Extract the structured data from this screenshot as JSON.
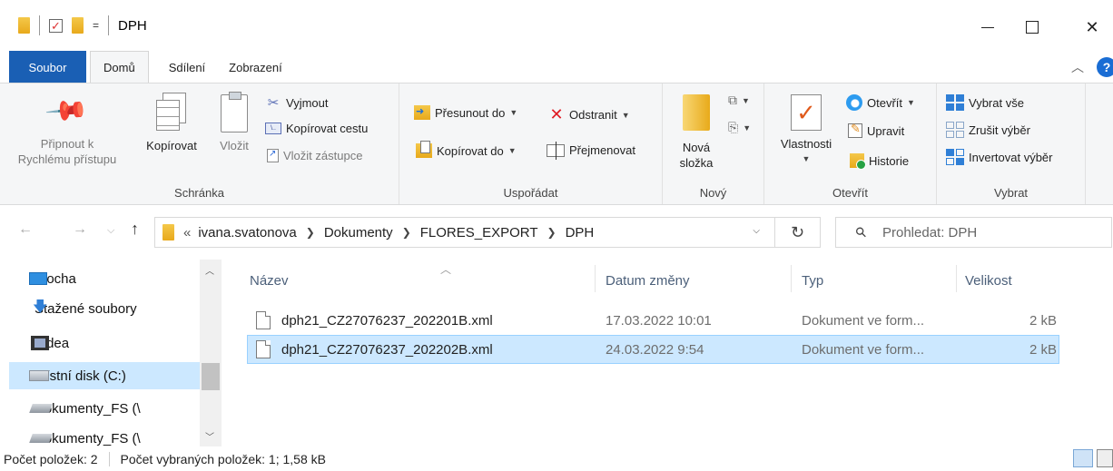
{
  "window": {
    "title": "DPH",
    "qat_dropdown": "=",
    "controls": {
      "minimize": "—",
      "maximize": "☐",
      "close": "✕"
    }
  },
  "tabs": [
    "Soubor",
    "Domů",
    "Sdílení",
    "Zobrazení"
  ],
  "ribbon": {
    "clipboard": {
      "pin_line1": "Připnout k",
      "pin_line2": "Rychlému přístupu",
      "copy": "Kopírovat",
      "paste": "Vložit",
      "cut": "Vyjmout",
      "copy_path": "Kopírovat cestu",
      "paste_shortcut": "Vložit zástupce",
      "group": "Schránka"
    },
    "organize": {
      "move_to": "Přesunout do",
      "delete": "Odstranit",
      "copy_to": "Kopírovat do",
      "rename": "Přejmenovat",
      "group": "Uspořádat"
    },
    "new": {
      "new_folder_line1": "Nová",
      "new_folder_line2": "složka",
      "group": "Nový"
    },
    "open": {
      "properties": "Vlastnosti",
      "open": "Otevřít",
      "edit": "Upravit",
      "history": "Historie",
      "group": "Otevřít"
    },
    "select": {
      "select_all": "Vybrat vše",
      "select_none": "Zrušit výběr",
      "invert": "Invertovat výběr",
      "group": "Vybrat"
    }
  },
  "address": {
    "overflow": "«",
    "crumbs": [
      "ivana.svatonova",
      "Dokumenty",
      "FLORES_EXPORT",
      "DPH"
    ],
    "search_placeholder": "Prohledat: DPH"
  },
  "nav_items": [
    {
      "label": "Plocha",
      "icon": "desktop-icon"
    },
    {
      "label": "Stažené soubory",
      "icon": "downloads-icon"
    },
    {
      "label": "Videa",
      "icon": "videos-icon"
    },
    {
      "label": "Místní disk (C:)",
      "icon": "local-disk-icon",
      "selected": true
    },
    {
      "label": "Dokumenty_FS (\\",
      "icon": "network-drive-icon"
    },
    {
      "label": "Dokumenty_FS (\\",
      "icon": "network-drive-icon"
    }
  ],
  "columns": [
    "Název",
    "Datum změny",
    "Typ",
    "Velikost"
  ],
  "files": [
    {
      "name": "dph21_CZ27076237_202201B.xml",
      "date": "17.03.2022 10:01",
      "type": "Dokument ve form...",
      "size": "2 kB",
      "selected": false
    },
    {
      "name": "dph21_CZ27076237_202202B.xml",
      "date": "24.03.2022 9:54",
      "type": "Dokument ve form...",
      "size": "2 kB",
      "selected": true
    }
  ],
  "status": {
    "count": "Počet položek: 2",
    "selected": "Počet vybraných položek: 1; 1,58 kB"
  }
}
